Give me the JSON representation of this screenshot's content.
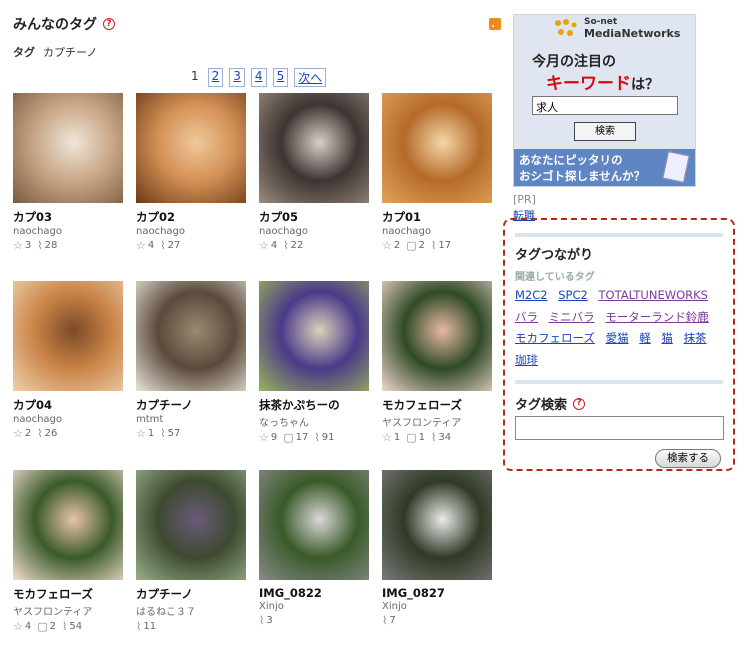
{
  "header": {
    "title": "みんなのタグ",
    "crumb_label": "タグ",
    "crumb_value": "カプチーノ"
  },
  "pager": {
    "current": "1",
    "pages": [
      "2",
      "3",
      "4",
      "5"
    ],
    "next": "次へ"
  },
  "items": [
    {
      "title": "カプ03",
      "user": "naochago",
      "stats": [
        "3",
        "28"
      ],
      "icons": [
        "star-icon",
        "clip-icon"
      ],
      "colors": [
        "#c9a889",
        "#7a5a3d",
        "#efe6d8"
      ]
    },
    {
      "title": "カプ02",
      "user": "naochago",
      "stats": [
        "4",
        "27"
      ],
      "icons": [
        "star-icon",
        "clip-icon"
      ],
      "colors": [
        "#d39156",
        "#6b3a16",
        "#f0c89b"
      ]
    },
    {
      "title": "カプ05",
      "user": "naochago",
      "stats": [
        "4",
        "22"
      ],
      "icons": [
        "star-icon",
        "clip-icon"
      ],
      "colors": [
        "#3c3532",
        "#9a8b7e",
        "#d8cfc6"
      ]
    },
    {
      "title": "カプ01",
      "user": "naochago",
      "stats": [
        "2",
        "2",
        "17"
      ],
      "icons": [
        "star-icon",
        "comment-icon",
        "clip-icon"
      ],
      "colors": [
        "#b56a2a",
        "#e1a45c",
        "#f4d7a6"
      ]
    },
    {
      "title": "カプ04",
      "user": "naochago",
      "stats": [
        "2",
        "26"
      ],
      "icons": [
        "star-icon",
        "clip-icon"
      ],
      "colors": [
        "#c98347",
        "#f0d1ad",
        "#7b4a26"
      ]
    },
    {
      "title": "カプチーノ",
      "user": "mtmt",
      "stats": [
        "1",
        "57"
      ],
      "icons": [
        "star-icon",
        "clip-icon"
      ],
      "colors": [
        "#5b4a3c",
        "#e9e4d8",
        "#9a8a70"
      ]
    },
    {
      "title": "抹茶かぷちーの",
      "user": "なっちゃん",
      "stats": [
        "9",
        "17",
        "91"
      ],
      "icons": [
        "star-icon",
        "comment-icon",
        "clip-icon"
      ],
      "colors": [
        "#4a3a8a",
        "#9bb45a",
        "#dcd2b8"
      ]
    },
    {
      "title": "モカフェローズ",
      "user": "ヤスフロンティア",
      "stats": [
        "1",
        "1",
        "34"
      ],
      "icons": [
        "star-icon",
        "comment-icon",
        "clip-icon"
      ],
      "colors": [
        "#2f4a25",
        "#f1d8cf",
        "#e8b9a7"
      ]
    },
    {
      "title": "モカフェローズ",
      "user": "ヤスフロンティア",
      "stats": [
        "4",
        "2",
        "54"
      ],
      "icons": [
        "star-icon",
        "comment-icon",
        "clip-icon"
      ],
      "colors": [
        "#3a5a2a",
        "#f5e0d2",
        "#e9c3ad"
      ]
    },
    {
      "title": "カプチーノ",
      "user": "はるねこ３７",
      "stats": [
        "11"
      ],
      "icons": [
        "clip-icon"
      ],
      "colors": [
        "#3d4a30",
        "#9ab08a",
        "#6a5a7a"
      ]
    },
    {
      "title": "IMG_0822",
      "user": "Xinjo",
      "stats": [
        "3"
      ],
      "icons": [
        "clip-icon"
      ],
      "colors": [
        "#3a5a2a",
        "#8a8a8a",
        "#d9d9d9"
      ]
    },
    {
      "title": "IMG_0827",
      "user": "Xinjo",
      "stats": [
        "7"
      ],
      "icons": [
        "clip-icon"
      ],
      "colors": [
        "#2f3a25",
        "#7a7a7a",
        "#eaeaea"
      ]
    }
  ],
  "ad": {
    "logo_line1": "So-net",
    "logo_line2": "MediaNetworks",
    "heading1": "今月の注目の",
    "heading2_em": "キーワード",
    "heading2_tail": "は？",
    "input_value": "求人",
    "button_label": "検索",
    "foot_line1": "あなたにピッタリの",
    "foot_line2": "おシゴト探しませんか？",
    "pr_label": "[PR]",
    "pr_link": "転職"
  },
  "tag_links": {
    "title": "タグつながり",
    "subtitle": "関連しているタグ",
    "tags": [
      "M2C2",
      "SPC2",
      "TOTALTUNEWORKS",
      "バラ",
      "ミニバラ",
      "モーターランド鈴鹿",
      "モカフェローズ",
      "愛猫",
      "軽",
      "猫",
      "抹茶",
      "珈琲"
    ],
    "visited": [
      "TOTALTUNEWORKS",
      "バラ",
      "ミニバラ",
      "モーターランド鈴鹿"
    ]
  },
  "tag_search": {
    "title": "タグ検索",
    "button_label": "検索する",
    "input_value": ""
  },
  "theme": {
    "link": "#1a44bb",
    "accent_border": "#b32b10",
    "help": "#cc2222"
  }
}
